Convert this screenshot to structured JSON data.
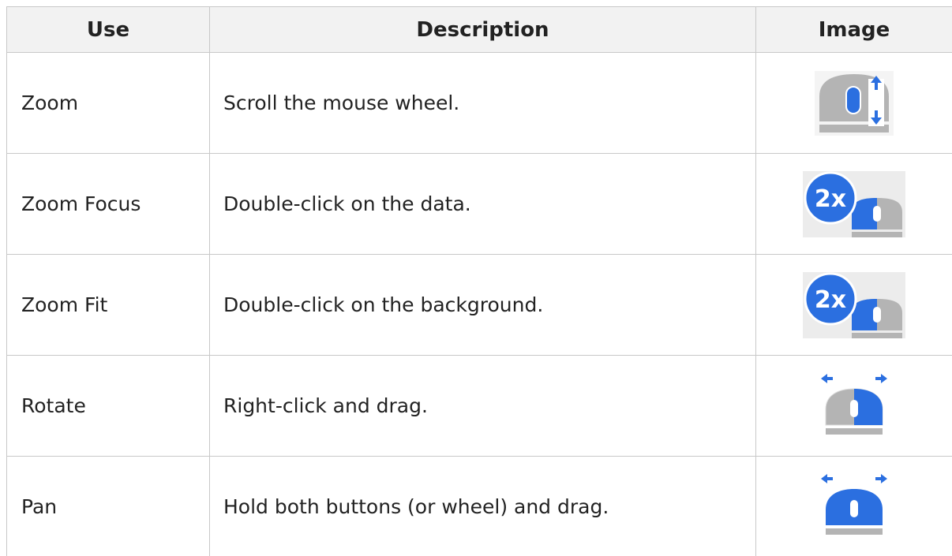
{
  "headers": {
    "use": "Use",
    "description": "Description",
    "image": "Image"
  },
  "rows": [
    {
      "use": "Zoom",
      "description": "Scroll the mouse wheel.",
      "icon": "mouse-wheel-scroll-icon"
    },
    {
      "use": "Zoom Focus",
      "description": "Double-click on the data.",
      "icon": "mouse-double-click-icon",
      "badge": "2x"
    },
    {
      "use": "Zoom Fit",
      "description": "Double-click on the background.",
      "icon": "mouse-double-click-icon",
      "badge": "2x"
    },
    {
      "use": "Rotate",
      "description": "Right-click and drag.",
      "icon": "mouse-right-drag-icon"
    },
    {
      "use": "Pan",
      "description": "Hold both buttons (or wheel) and drag.",
      "icon": "mouse-both-drag-icon"
    }
  ],
  "colors": {
    "accent": "#2b6fe0",
    "mouse_gray": "#b4b4b4",
    "header_bg": "#f2f2f2",
    "border": "#c8c8c8"
  }
}
